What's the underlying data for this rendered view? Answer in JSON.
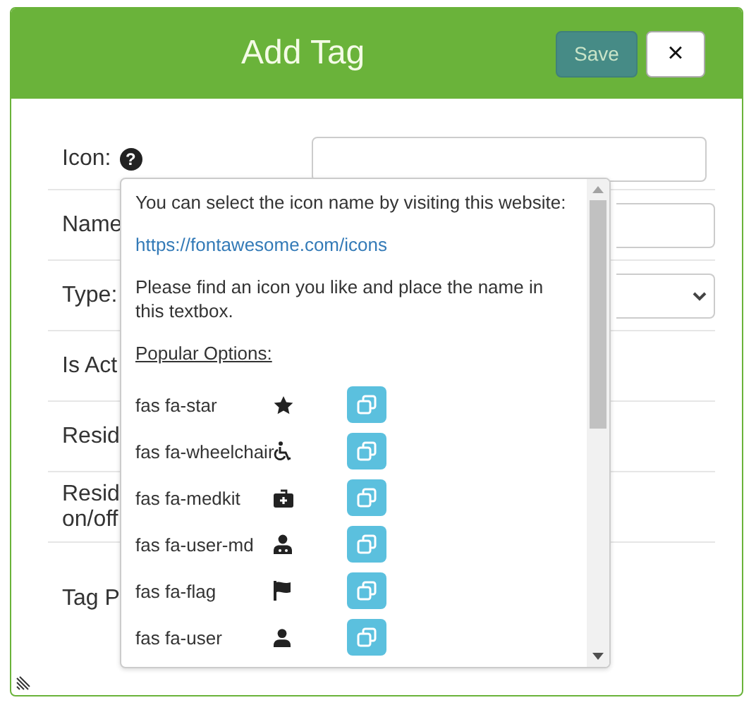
{
  "dialog": {
    "title": "Add Tag",
    "save_button": "Save",
    "close_button": "×"
  },
  "form": {
    "rows": [
      {
        "label": "Icon:",
        "kind": "text",
        "help": "?"
      },
      {
        "label": "Name",
        "kind": "text"
      },
      {
        "label": "Type:",
        "kind": "select"
      },
      {
        "label": "Is Act",
        "kind": "none"
      },
      {
        "label": "Resid",
        "kind": "none"
      },
      {
        "label": "Resid\non/off",
        "kind": "none"
      },
      {
        "label": "Tag P",
        "kind": "none"
      }
    ]
  },
  "help_popup": {
    "intro": "You can select the icon name by visiting this website:",
    "link": "https://fontawesome.com/icons",
    "instruction": "Please find an icon you like and place the name in this textbox.",
    "options_heading": "Popular Options:",
    "options": [
      {
        "name": "fas fa-star",
        "kind": "star"
      },
      {
        "name": "fas fa-wheelchair",
        "kind": "wheelchair"
      },
      {
        "name": "fas fa-medkit",
        "kind": "medkit"
      },
      {
        "name": "fas fa-user-md",
        "kind": "user-md"
      },
      {
        "name": "fas fa-flag",
        "kind": "flag"
      },
      {
        "name": "fas fa-user",
        "kind": "user"
      }
    ]
  }
}
